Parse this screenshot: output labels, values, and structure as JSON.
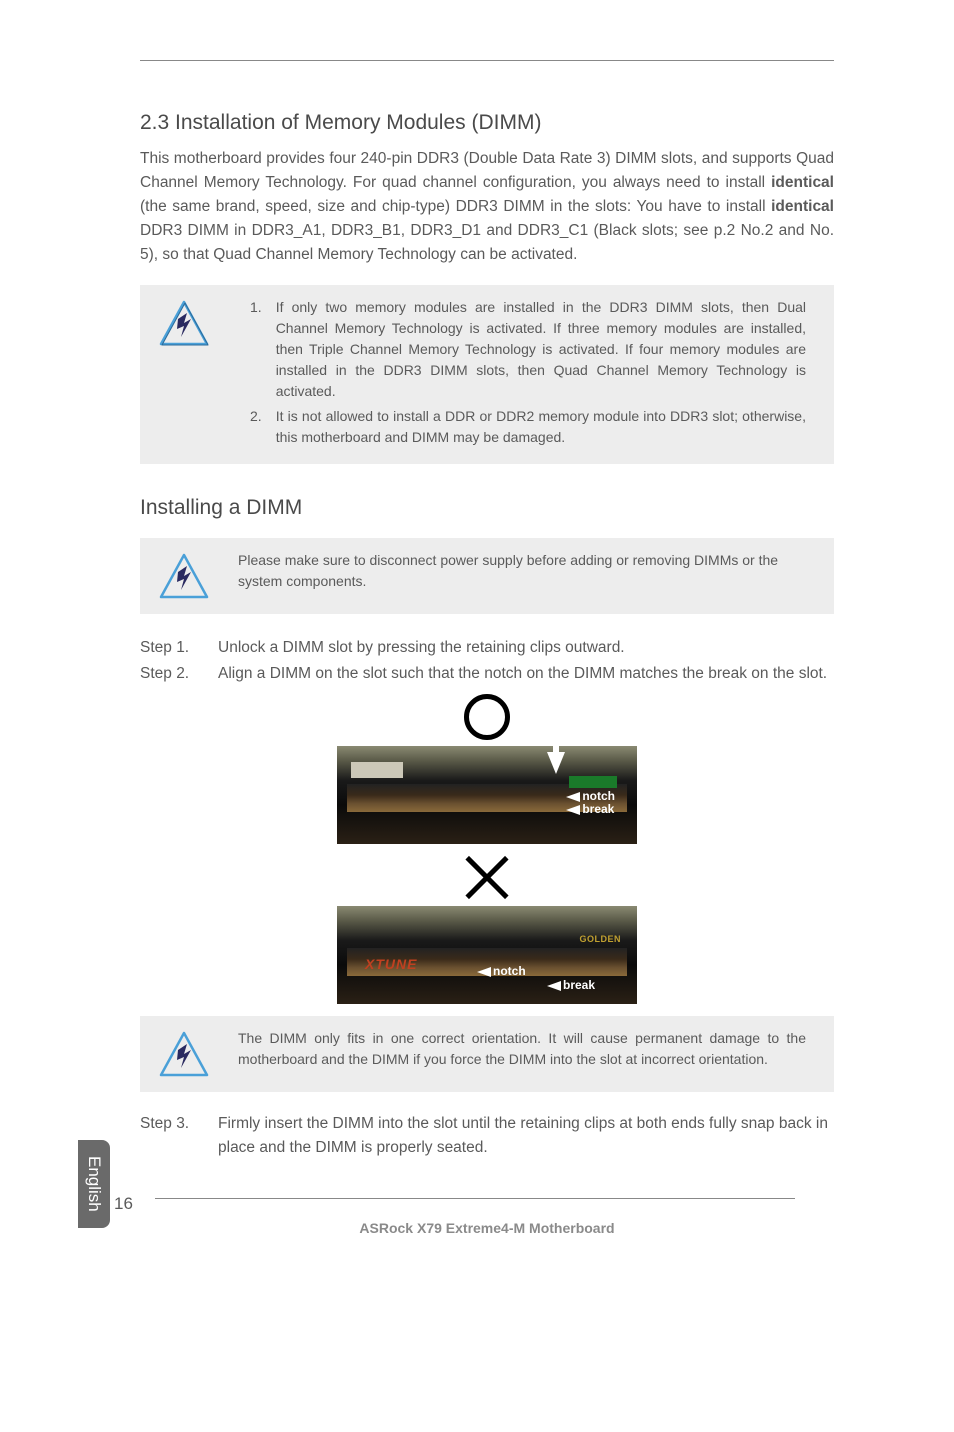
{
  "section_number_title": "2.3  Installation of Memory Modules (DIMM)",
  "intro_parts": {
    "p1": "This motherboard provides four 240-pin DDR3 (Double Data Rate 3) DIMM slots, and supports Quad Channel Memory Technology. For quad channel configuration, you always need to install ",
    "b1": "identical",
    "p2": " (the same brand, speed, size and chip-type) DDR3 DIMM in the slots: You have to install ",
    "b2": "identical",
    "p3": " DDR3 DIMM in DDR3_A1, DDR3_B1, DDR3_D1 and DDR3_C1 (Black slots; see p.2 No.2 and No. 5), so that Quad Channel Memory Technology can be activated."
  },
  "notes": {
    "n1_num": "1.",
    "n1": "If only two memory modules are installed in the DDR3 DIMM slots, then Dual Channel Memory Technology is activated. If three memory modules are installed, then Triple Channel Memory Technology is activated. If four memory modules are installed in the DDR3 DIMM slots, then Quad Channel Memory Technology is activated.",
    "n2_num": "2.",
    "n2": "It is not allowed to install a DDR or DDR2 memory module into DDR3 slot; otherwise, this motherboard and DIMM may be damaged."
  },
  "sub_title": "Installing a DIMM",
  "power_note": "Please make sure to disconnect power supply before adding or removing DIMMs or the system components.",
  "steps": {
    "s1_label": "Step 1.",
    "s1": "Unlock a DIMM slot by pressing the retaining clips outward.",
    "s2_label": "Step 2.",
    "s2": "Align a DIMM on the slot such that the notch on the DIMM matches the break on the slot.",
    "s3_label": "Step 3.",
    "s3": "Firmly insert the DIMM into the slot until the retaining clips at both ends fully snap back in place and the DIMM is properly seated."
  },
  "img_labels": {
    "notch": "notch",
    "break": "break",
    "xtune": "XTUNE",
    "golden": "GOLDEN"
  },
  "orientation_note": "The DIMM only fits in one correct orientation. It will cause permanent damage to the motherboard and the DIMM if you force the DIMM into the slot at incorrect orientation.",
  "side_tab": "English",
  "page_number": "16",
  "footer": "ASRock  X79  Extreme4-M  Motherboard"
}
